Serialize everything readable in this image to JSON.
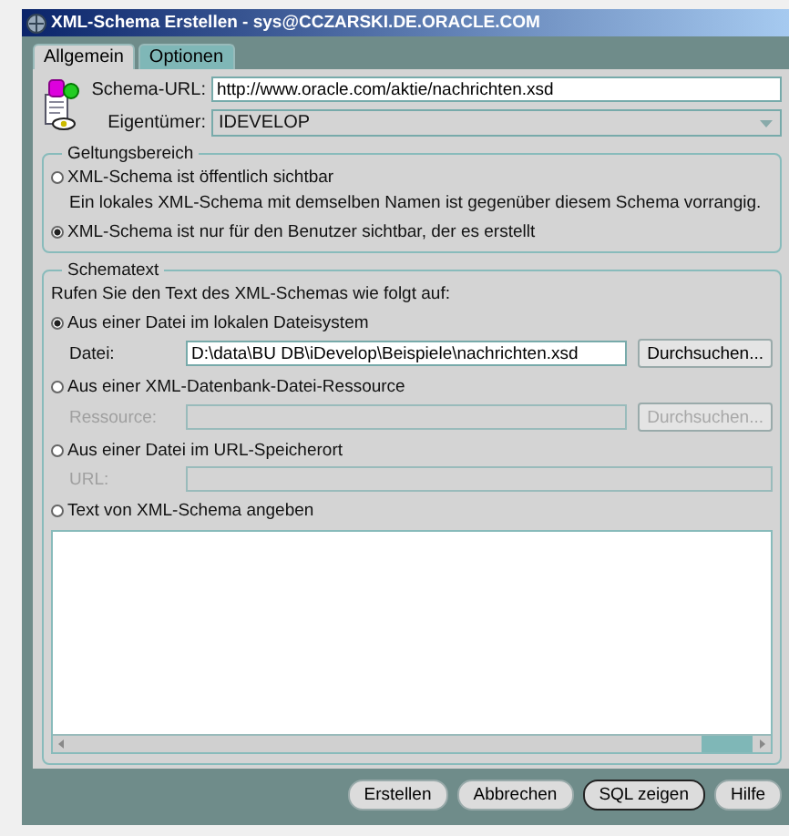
{
  "window": {
    "title": "XML-Schema Erstellen - sys@CCZARSKI.DE.ORACLE.COM"
  },
  "tabs": [
    {
      "label": "Allgemein",
      "selected": true
    },
    {
      "label": "Optionen",
      "selected": false
    }
  ],
  "schema_url": {
    "label": "Schema-URL:",
    "value": "http://www.oracle.com/aktie/nachrichten.xsd"
  },
  "owner": {
    "label": "Eigentümer:",
    "value": "IDEVELOP"
  },
  "scope": {
    "title": "Geltungsbereich",
    "options": [
      {
        "label": "XML-Schema ist öffentlich sichtbar",
        "note": "Ein lokales XML-Schema mit demselben Namen ist gegenüber diesem Schema vorrangig.",
        "selected": false
      },
      {
        "label": "XML-Schema ist nur für den Benutzer sichtbar, der es erstellt",
        "selected": true
      }
    ]
  },
  "schema_text": {
    "title": "Schematext",
    "intro": "Rufen Sie den Text des XML-Schemas wie folgt auf:",
    "options": [
      {
        "kind": "file",
        "label": "Aus einer Datei im lokalen Dateisystem",
        "selected": true,
        "field_label": "Datei:",
        "value": "D:\\data\\BU DB\\iDevelop\\Beispiele\\nachrichten.xsd",
        "button": "Durchsuchen...",
        "disabled": false
      },
      {
        "kind": "resource",
        "label": "Aus einer XML-Datenbank-Datei-Ressource",
        "selected": false,
        "field_label": "Ressource:",
        "button": "Durchsuchen...",
        "disabled": true
      },
      {
        "kind": "url",
        "label": "Aus einer Datei im URL-Speicherort",
        "selected": false,
        "field_label": "URL:",
        "disabled": true
      },
      {
        "kind": "text",
        "label": "Text von XML-Schema angeben",
        "selected": false
      }
    ]
  },
  "buttons": [
    {
      "label": "Erstellen",
      "focused": false
    },
    {
      "label": "Abbrechen",
      "focused": false
    },
    {
      "label": "SQL zeigen",
      "focused": true
    },
    {
      "label": "Hilfe",
      "focused": false
    }
  ]
}
